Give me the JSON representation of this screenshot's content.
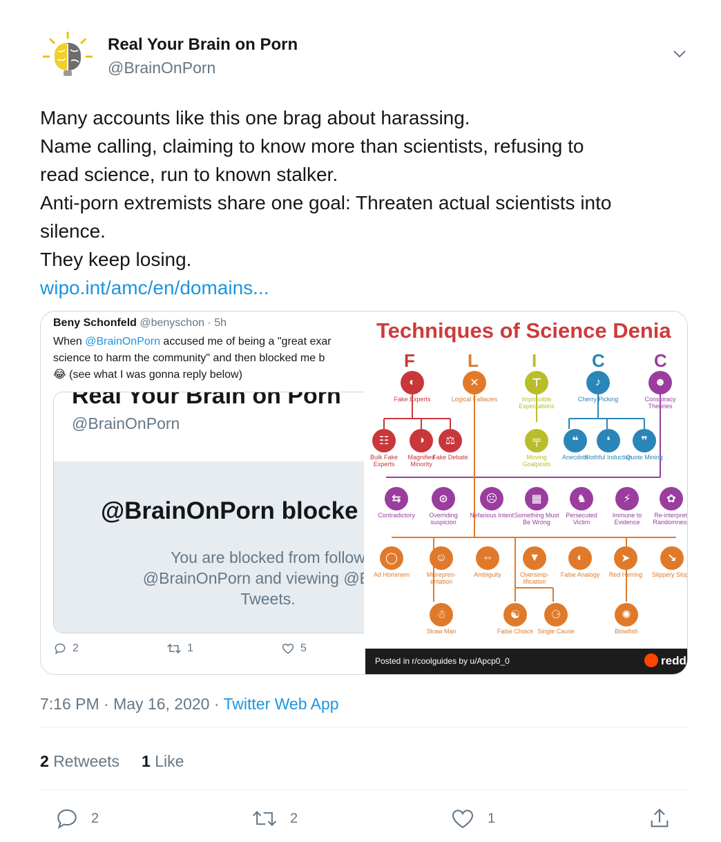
{
  "tweet": {
    "author_name": "Real Your Brain on Porn",
    "author_handle": "@BrainOnPorn",
    "avatar_icon": "brain-sun-logo",
    "text_lines": [
      "Many accounts like this one brag about harassing.",
      "Name calling, claiming to know more than scientists, refusing to",
      "read science, run to known stalker.",
      "Anti-porn extremists share one goal: Threaten actual scientists into",
      "silence.",
      "They keep losing."
    ],
    "link_text": "wipo.int/amc/en/domains...",
    "time": "7:16 PM · May 16, 2020 · ",
    "source": "Twitter Web App",
    "retweets_count": "2",
    "retweets_label": "Retweets",
    "likes_count": "1",
    "likes_label": "Like",
    "action_reply_count": "2",
    "action_retweet_count": "2",
    "action_like_count": "1"
  },
  "quoted": {
    "name": "Beny Schonfeld",
    "handle_time": "@benyschon · 5h",
    "line1_pre": "When ",
    "line1_mention": "@BrainOnPorn",
    "line1_post": " accused me of being a \"great exar",
    "line2": "science to harm the community\" and then blocked me b",
    "line3": "😂 (see what I was gonna reply below)",
    "inner_title": "Real Your Brain on Porn",
    "inner_handle": "@BrainOnPorn",
    "blocked_title": "@BrainOnPorn blocke",
    "blocked_line1": "You are blocked from follow",
    "blocked_line2": "@BrainOnPorn and viewing @Brair",
    "blocked_line3": "Tweets.",
    "reply_count": "2",
    "retweet_count": "1",
    "like_count": "5"
  },
  "chart": {
    "title": "Techniques of Science Denia",
    "letters": [
      "F",
      "L",
      "I",
      "C",
      "C"
    ],
    "colors": {
      "red": "#c8373a",
      "orange": "#e07a2a",
      "yellow": "#b9bd2c",
      "blue": "#2a86b8",
      "purple": "#9a3d9e"
    },
    "labels": {
      "fake_experts": "Fake Experts",
      "logical_fallacies": "Logical Fallacies",
      "impossible_expectations": "Impossible Expectations",
      "cherry_picking": "Cherry Picking",
      "conspiracy_theories": "Conspiracy Theories",
      "bulk_fake_experts": "Bulk Fake Experts",
      "magnified_minority": "Magnified Minority",
      "fake_debate": "Fake Debate",
      "moving_goalposts": "Moving Goalposts",
      "anecdote": "Anecdote",
      "slothful_induction": "Slothful Induction",
      "quote_mining": "Quote Mining",
      "contradictory": "Contradictory",
      "overriding_suspicion": "Overriding suspicion",
      "nefarious_intent": "Nefarious Intent",
      "something_wrong": "Something Must Be Wrong",
      "persecuted_victim": "Persecuted Victim",
      "immune_to_evidence": "Immune to Evidence",
      "reinterpreting": "Re-interpreti Randomness",
      "ad_hominem": "Ad Hominem",
      "misrepresentation": "Misrepres- entation",
      "ambiguity": "Ambiguity",
      "oversimplification": "Oversimp- lification",
      "false_analogy": "False Analogy",
      "red_herring": "Red Herring",
      "slippery_slope": "Slippery Slope",
      "straw_man": "Straw Man",
      "false_choice": "False Choice",
      "single_cause": "Single Cause",
      "blowfish": "Blowfish"
    },
    "footer_posted": "Posted in r/coolguides by u/Apcp0_0",
    "footer_brand": "reddi"
  }
}
